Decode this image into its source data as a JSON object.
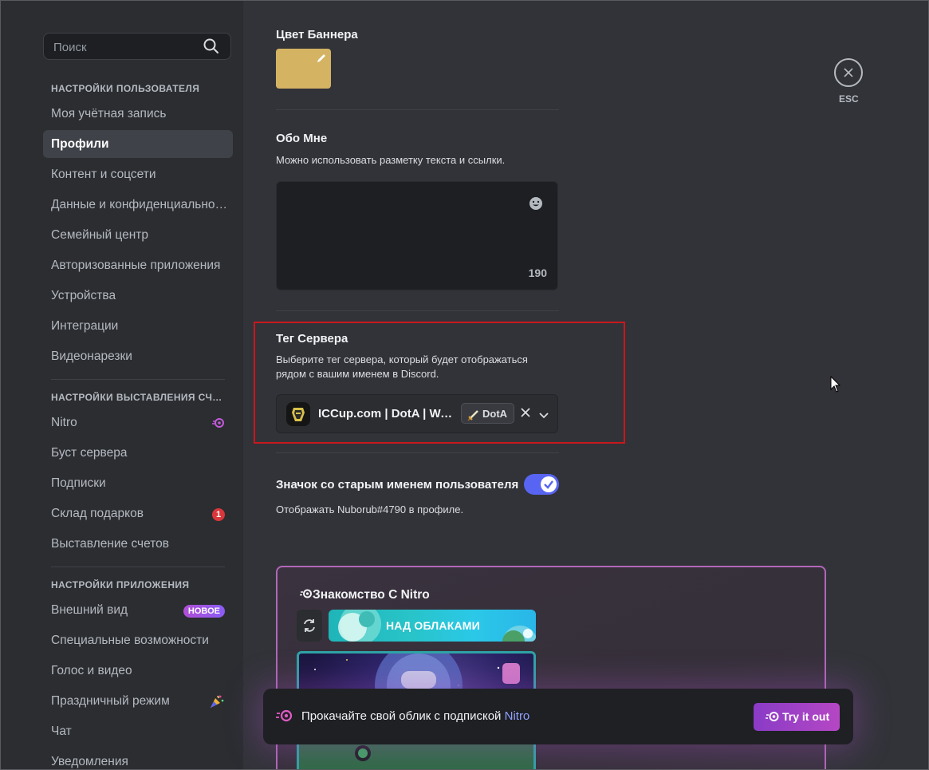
{
  "search": {
    "placeholder": "Поиск"
  },
  "sidebar": {
    "sections": [
      {
        "header": "НАСТРОЙКИ ПОЛЬЗОВАТЕЛЯ"
      },
      {
        "header": "НАСТРОЙКИ ВЫСТАВЛЕНИЯ СЧЕТОВ"
      },
      {
        "header": "НАСТРОЙКИ ПРИЛОЖЕНИЯ"
      }
    ],
    "user_items": [
      "Моя учётная запись",
      "Профили",
      "Контент и соцсети",
      "Данные и конфиденциальность",
      "Семейный центр",
      "Авторизованные приложения",
      "Устройства",
      "Интеграции",
      "Видеонарезки"
    ],
    "billing_items": [
      "Nitro",
      "Буст сервера",
      "Подписки",
      "Склад подарков",
      "Выставление счетов"
    ],
    "app_items": [
      "Внешний вид",
      "Специальные возможности",
      "Голос и видео",
      "Праздничный режим",
      "Чат",
      "Уведомления"
    ],
    "gift_badge": "1",
    "new_badge": "НОВОЕ",
    "active_item": "Профили"
  },
  "banner": {
    "label": "Цвет Баннера",
    "color": "#d4b363"
  },
  "about": {
    "label": "Обо Мне",
    "hint": "Можно использовать разметку текста и ссылки.",
    "char_count": "190"
  },
  "server_tag": {
    "label": "Тег Сервера",
    "hint_line1": "Выберите тег сервера, который будет отображаться",
    "hint_line2": "рядом с вашим именем в Discord.",
    "server_name": "ICCup.com | DotA | WarCraft",
    "tag": "DotA"
  },
  "legacy": {
    "label": "Значок со старым именем пользователя",
    "hint": "Отображать Nuborub#4790 в профиле.",
    "enabled": true
  },
  "nitro_card": {
    "title": "Знакомство С Nitro",
    "decoration_label": "НАД ОБЛАКАМИ"
  },
  "upsell": {
    "text": "Прокачайте свой облик с подпиской ",
    "link": "Nitro",
    "button": "Try it out"
  },
  "esc": {
    "label": "ESC"
  },
  "colors": {
    "accent": "#5865f2",
    "nitro": "#b547c4",
    "highlight": "#c8181d"
  }
}
